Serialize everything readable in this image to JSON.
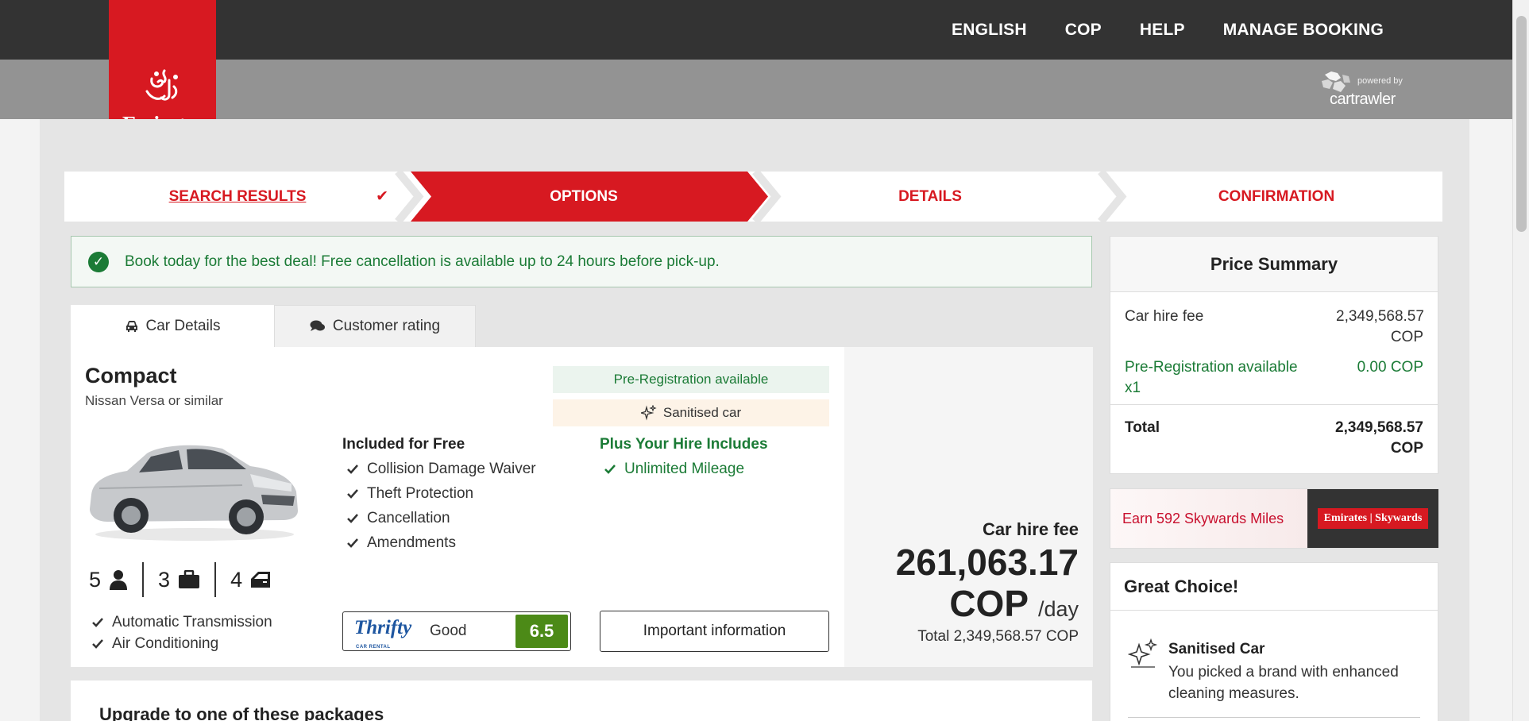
{
  "top_nav": [
    "ENGLISH",
    "COP",
    "HELP",
    "MANAGE BOOKING"
  ],
  "brand": {
    "name": "Emirates",
    "powered_small": "powered by",
    "powered_big": "cartrawler"
  },
  "steps": [
    "SEARCH RESULTS",
    "OPTIONS",
    "DETAILS",
    "CONFIRMATION"
  ],
  "colors": {
    "brand_red": "#d71921",
    "green": "#1b7b36",
    "dark": "#333333"
  },
  "notice": "Book today for the best deal! Free cancellation is available up to 24 hours before pick-up.",
  "tabs": {
    "car_details": "Car Details",
    "customer_rating": "Customer rating"
  },
  "car": {
    "category": "Compact",
    "model": "Nissan Versa or similar",
    "seats": "5",
    "bags": "3",
    "doors": "4",
    "features": [
      "Automatic Transmission",
      "Air Conditioning"
    ]
  },
  "badges": {
    "prereg": "Pre-Registration available",
    "sanitised": "Sanitised car"
  },
  "included": {
    "title": "Included for Free",
    "items": [
      "Collision Damage Waiver",
      "Theft Protection",
      "Cancellation",
      "Amendments"
    ]
  },
  "plus": {
    "title": "Plus Your Hire Includes",
    "items": [
      "Unlimited Mileage"
    ]
  },
  "supplier": {
    "name": "Thrifty",
    "tagline": "CAR RENTAL",
    "rating_text": "Good",
    "score": "6.5"
  },
  "important_info": "Important information",
  "price": {
    "label": "Car hire fee",
    "amount": "261,063.17",
    "currency": "COP",
    "per": "/day",
    "total": "Total 2,349,568.57 COP"
  },
  "upgrade_title": "Upgrade to one of these packages",
  "summary": {
    "title": "Price Summary",
    "rows": [
      {
        "label": "Car hire fee",
        "value": "2,349,568.57 COP"
      },
      {
        "label": "Pre-Registration available x1",
        "value": "0.00 COP"
      },
      {
        "label": "Total",
        "value": "2,349,568.57 COP"
      }
    ]
  },
  "skywards": {
    "earn": "Earn 592 Skywards Miles",
    "badge": "Emirates | Skywards"
  },
  "great": {
    "title": "Great Choice!",
    "item_title": "Sanitised Car",
    "item_desc": "You picked a brand with enhanced cleaning measures."
  }
}
